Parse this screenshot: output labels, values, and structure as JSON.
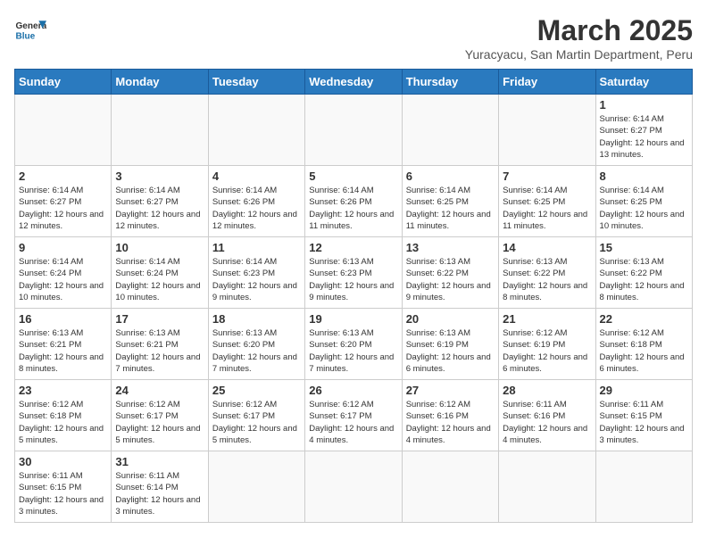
{
  "header": {
    "logo_general": "General",
    "logo_blue": "Blue",
    "month_title": "March 2025",
    "location": "Yuracyacu, San Martin Department, Peru"
  },
  "days_of_week": [
    "Sunday",
    "Monday",
    "Tuesday",
    "Wednesday",
    "Thursday",
    "Friday",
    "Saturday"
  ],
  "weeks": [
    [
      {
        "day": "",
        "info": ""
      },
      {
        "day": "",
        "info": ""
      },
      {
        "day": "",
        "info": ""
      },
      {
        "day": "",
        "info": ""
      },
      {
        "day": "",
        "info": ""
      },
      {
        "day": "",
        "info": ""
      },
      {
        "day": "1",
        "info": "Sunrise: 6:14 AM\nSunset: 6:27 PM\nDaylight: 12 hours\nand 13 minutes."
      }
    ],
    [
      {
        "day": "2",
        "info": "Sunrise: 6:14 AM\nSunset: 6:27 PM\nDaylight: 12 hours\nand 12 minutes."
      },
      {
        "day": "3",
        "info": "Sunrise: 6:14 AM\nSunset: 6:27 PM\nDaylight: 12 hours\nand 12 minutes."
      },
      {
        "day": "4",
        "info": "Sunrise: 6:14 AM\nSunset: 6:26 PM\nDaylight: 12 hours\nand 12 minutes."
      },
      {
        "day": "5",
        "info": "Sunrise: 6:14 AM\nSunset: 6:26 PM\nDaylight: 12 hours\nand 11 minutes."
      },
      {
        "day": "6",
        "info": "Sunrise: 6:14 AM\nSunset: 6:25 PM\nDaylight: 12 hours\nand 11 minutes."
      },
      {
        "day": "7",
        "info": "Sunrise: 6:14 AM\nSunset: 6:25 PM\nDaylight: 12 hours\nand 11 minutes."
      },
      {
        "day": "8",
        "info": "Sunrise: 6:14 AM\nSunset: 6:25 PM\nDaylight: 12 hours\nand 10 minutes."
      }
    ],
    [
      {
        "day": "9",
        "info": "Sunrise: 6:14 AM\nSunset: 6:24 PM\nDaylight: 12 hours\nand 10 minutes."
      },
      {
        "day": "10",
        "info": "Sunrise: 6:14 AM\nSunset: 6:24 PM\nDaylight: 12 hours\nand 10 minutes."
      },
      {
        "day": "11",
        "info": "Sunrise: 6:14 AM\nSunset: 6:23 PM\nDaylight: 12 hours\nand 9 minutes."
      },
      {
        "day": "12",
        "info": "Sunrise: 6:13 AM\nSunset: 6:23 PM\nDaylight: 12 hours\nand 9 minutes."
      },
      {
        "day": "13",
        "info": "Sunrise: 6:13 AM\nSunset: 6:22 PM\nDaylight: 12 hours\nand 9 minutes."
      },
      {
        "day": "14",
        "info": "Sunrise: 6:13 AM\nSunset: 6:22 PM\nDaylight: 12 hours\nand 8 minutes."
      },
      {
        "day": "15",
        "info": "Sunrise: 6:13 AM\nSunset: 6:22 PM\nDaylight: 12 hours\nand 8 minutes."
      }
    ],
    [
      {
        "day": "16",
        "info": "Sunrise: 6:13 AM\nSunset: 6:21 PM\nDaylight: 12 hours\nand 8 minutes."
      },
      {
        "day": "17",
        "info": "Sunrise: 6:13 AM\nSunset: 6:21 PM\nDaylight: 12 hours\nand 7 minutes."
      },
      {
        "day": "18",
        "info": "Sunrise: 6:13 AM\nSunset: 6:20 PM\nDaylight: 12 hours\nand 7 minutes."
      },
      {
        "day": "19",
        "info": "Sunrise: 6:13 AM\nSunset: 6:20 PM\nDaylight: 12 hours\nand 7 minutes."
      },
      {
        "day": "20",
        "info": "Sunrise: 6:13 AM\nSunset: 6:19 PM\nDaylight: 12 hours\nand 6 minutes."
      },
      {
        "day": "21",
        "info": "Sunrise: 6:12 AM\nSunset: 6:19 PM\nDaylight: 12 hours\nand 6 minutes."
      },
      {
        "day": "22",
        "info": "Sunrise: 6:12 AM\nSunset: 6:18 PM\nDaylight: 12 hours\nand 6 minutes."
      }
    ],
    [
      {
        "day": "23",
        "info": "Sunrise: 6:12 AM\nSunset: 6:18 PM\nDaylight: 12 hours\nand 5 minutes."
      },
      {
        "day": "24",
        "info": "Sunrise: 6:12 AM\nSunset: 6:17 PM\nDaylight: 12 hours\nand 5 minutes."
      },
      {
        "day": "25",
        "info": "Sunrise: 6:12 AM\nSunset: 6:17 PM\nDaylight: 12 hours\nand 5 minutes."
      },
      {
        "day": "26",
        "info": "Sunrise: 6:12 AM\nSunset: 6:17 PM\nDaylight: 12 hours\nand 4 minutes."
      },
      {
        "day": "27",
        "info": "Sunrise: 6:12 AM\nSunset: 6:16 PM\nDaylight: 12 hours\nand 4 minutes."
      },
      {
        "day": "28",
        "info": "Sunrise: 6:11 AM\nSunset: 6:16 PM\nDaylight: 12 hours\nand 4 minutes."
      },
      {
        "day": "29",
        "info": "Sunrise: 6:11 AM\nSunset: 6:15 PM\nDaylight: 12 hours\nand 3 minutes."
      }
    ],
    [
      {
        "day": "30",
        "info": "Sunrise: 6:11 AM\nSunset: 6:15 PM\nDaylight: 12 hours\nand 3 minutes."
      },
      {
        "day": "31",
        "info": "Sunrise: 6:11 AM\nSunset: 6:14 PM\nDaylight: 12 hours\nand 3 minutes."
      },
      {
        "day": "",
        "info": ""
      },
      {
        "day": "",
        "info": ""
      },
      {
        "day": "",
        "info": ""
      },
      {
        "day": "",
        "info": ""
      },
      {
        "day": "",
        "info": ""
      }
    ]
  ]
}
